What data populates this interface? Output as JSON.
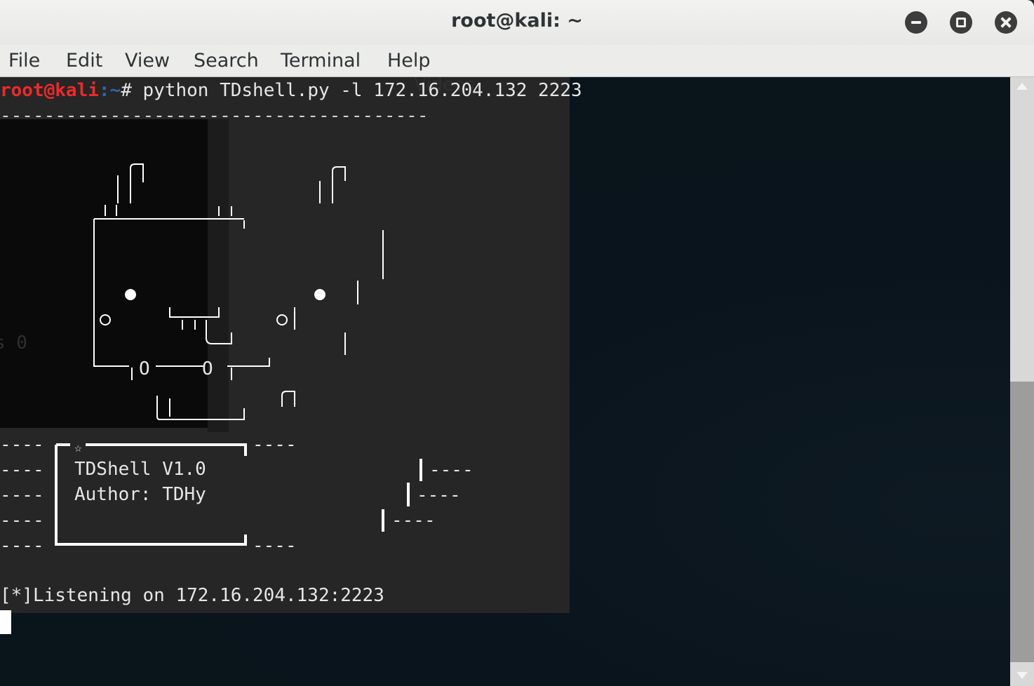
{
  "window": {
    "title": "root@kali: ~"
  },
  "menu": [
    "File",
    "Edit",
    "View",
    "Search",
    "Terminal",
    "Help"
  ],
  "terminal": {
    "prompt_user": "root@kali",
    "prompt_path": ":~",
    "prompt_symbol": "# ",
    "command": "python TDshell.py -l 172.16.204.132 2223",
    "divider": "---------------------------------------",
    "banner_name": "TDShell V1.0",
    "banner_author": "Author: TDHy",
    "status": "[*]Listening on 172.16.204.132:2223",
    "ghost_text_1": "Videos",
    "ghost_text_2": "s 0"
  }
}
